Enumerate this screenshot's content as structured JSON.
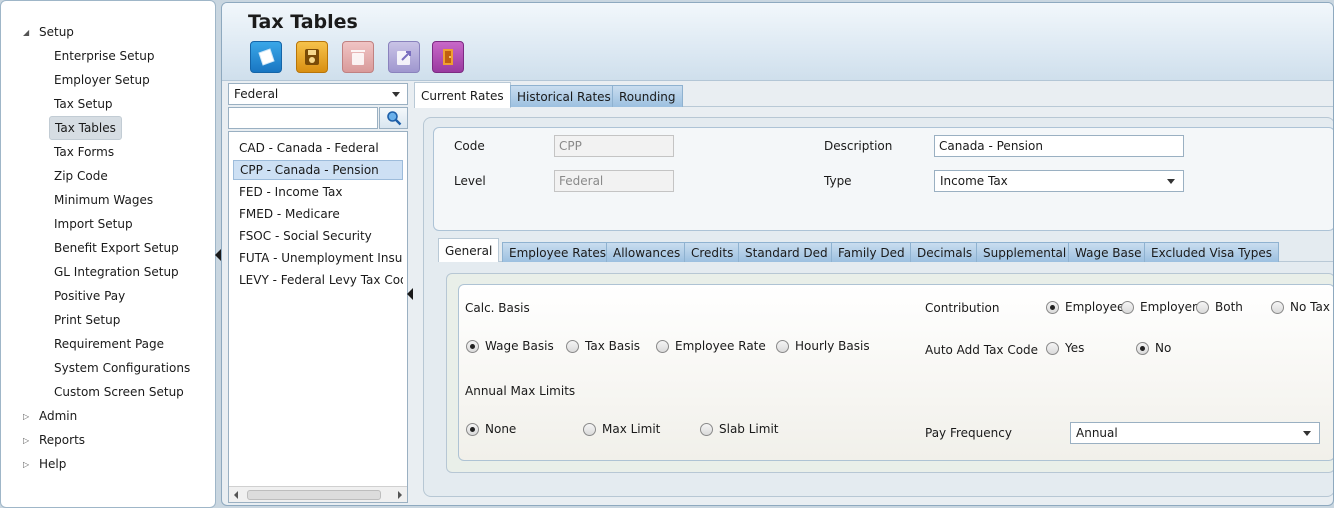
{
  "nav": {
    "setup_label": "Setup",
    "setup_items": [
      "Enterprise Setup",
      "Employer Setup",
      "Tax Setup",
      "Tax Tables",
      "Tax Forms",
      "Zip Code",
      "Minimum Wages",
      "Import Setup",
      "Benefit Export Setup",
      "GL Integration Setup",
      "Positive Pay",
      "Print Setup",
      "Requirement Page",
      "System Configurations",
      "Custom Screen Setup"
    ],
    "selected_item": "Tax Tables",
    "admin_label": "Admin",
    "reports_label": "Reports",
    "help_label": "Help"
  },
  "header": {
    "title": "Tax Tables"
  },
  "toolbar": {
    "icons": [
      "new-icon",
      "save-icon",
      "delete-icon",
      "export-icon",
      "exit-icon"
    ]
  },
  "list": {
    "filter_value": "Federal",
    "search_value": "",
    "items": [
      "CAD - Canada - Federal",
      "CPP - Canada - Pension",
      "FED - Income Tax",
      "FMED - Medicare",
      "FSOC - Social Security",
      "FUTA - Unemployment Insura",
      "LEVY - Federal Levy Tax Code"
    ],
    "selected_index": 1
  },
  "tabs": [
    "Current Rates",
    "Historical Rates",
    "Rounding"
  ],
  "form": {
    "code_label": "Code",
    "code_value": "CPP",
    "description_label": "Description",
    "description_value": "Canada - Pension",
    "level_label": "Level",
    "level_value": "Federal",
    "type_label": "Type",
    "type_value": "Income Tax"
  },
  "subtabs": [
    "General",
    "Employee Rates",
    "Allowances",
    "Credits",
    "Standard Ded",
    "Family Ded",
    "Decimals",
    "Supplemental",
    "Wage Base",
    "Excluded Visa Types"
  ],
  "general": {
    "calc_basis_label": "Calc. Basis",
    "calc_basis_options": [
      "Wage Basis",
      "Tax Basis",
      "Employee Rate",
      "Hourly Basis"
    ],
    "calc_basis_selected": "Wage Basis",
    "contribution_label": "Contribution",
    "contribution_options": [
      "Employee",
      "Employer",
      "Both",
      "No Tax"
    ],
    "contribution_selected": "Employee",
    "auto_add_label": "Auto Add Tax Code",
    "auto_add_options": [
      "Yes",
      "No"
    ],
    "auto_add_selected": "No",
    "annual_max_label": "Annual Max Limits",
    "annual_max_options": [
      "None",
      "Max Limit",
      "Slab Limit"
    ],
    "annual_max_selected": "None",
    "pay_frequency_label": "Pay Frequency",
    "pay_frequency_value": "Annual"
  }
}
